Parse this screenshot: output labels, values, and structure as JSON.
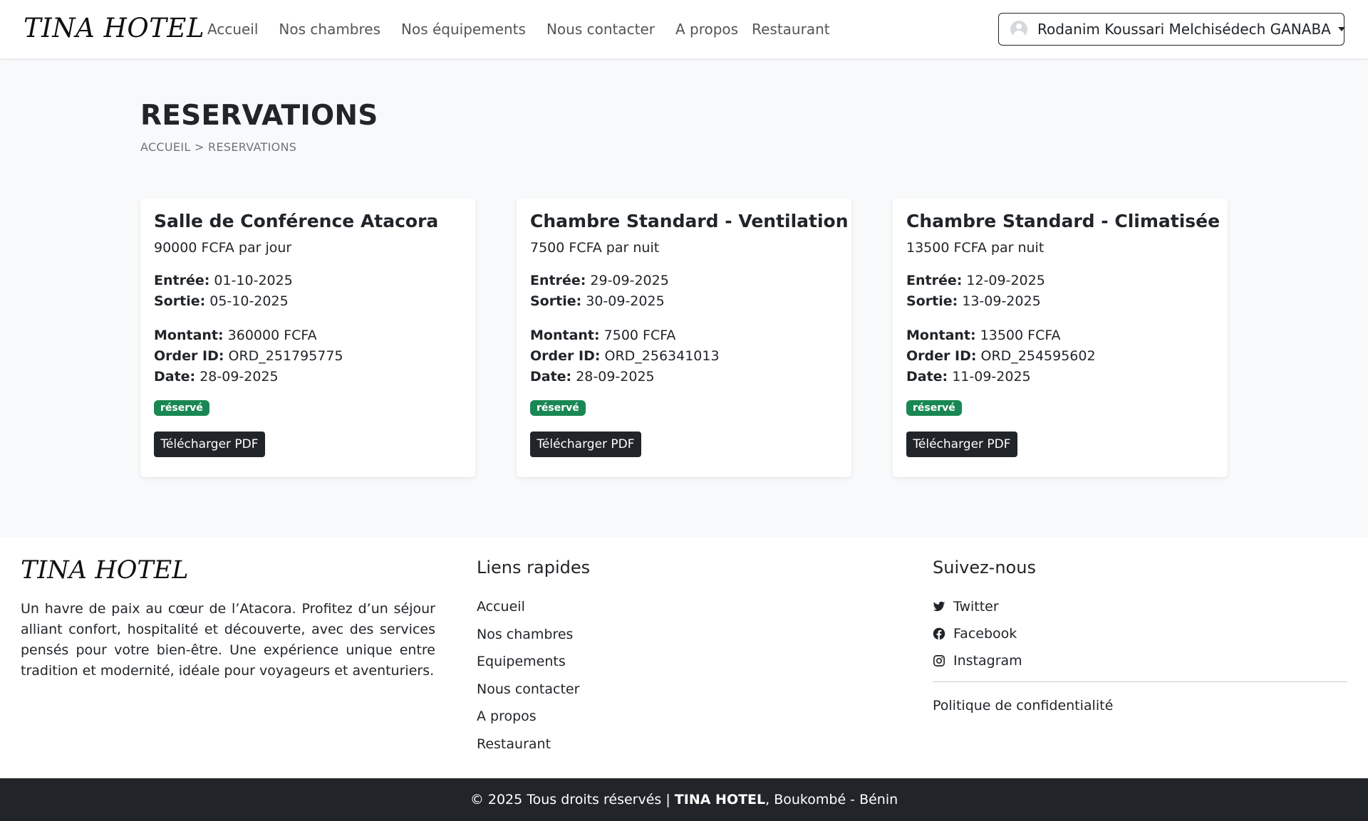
{
  "nav": {
    "brand": "TINA HOTEL",
    "links": [
      "Accueil",
      "Nos chambres",
      "Nos équipements",
      "Nous contacter",
      "A propos",
      "Restaurant"
    ],
    "user_name": "Rodanim Koussari Melchisédech GANABA"
  },
  "header": {
    "title": "RESERVATIONS",
    "breadcrumb": "ACCUEIL > RESERVATIONS"
  },
  "labels": {
    "entree": "Entrée:",
    "sortie": "Sortie:",
    "montant": "Montant:",
    "order_id": "Order ID:",
    "date": "Date:",
    "download": "Télécharger PDF"
  },
  "reservations": [
    {
      "title": "Salle de Conférence Atacora",
      "price": "90000 FCFA par jour",
      "entree": "01-10-2025",
      "sortie": "05-10-2025",
      "montant": "360000 FCFA",
      "order_id": "ORD_251795775",
      "date": "28-09-2025",
      "status": "réservé"
    },
    {
      "title": "Chambre Standard - Ventilation",
      "price": "7500 FCFA par nuit",
      "entree": "29-09-2025",
      "sortie": "30-09-2025",
      "montant": "7500 FCFA",
      "order_id": "ORD_256341013",
      "date": "28-09-2025",
      "status": "réservé"
    },
    {
      "title": "Chambre Standard - Climatisée",
      "price": "13500 FCFA par nuit",
      "entree": "12-09-2025",
      "sortie": "13-09-2025",
      "montant": "13500 FCFA",
      "order_id": "ORD_254595602",
      "date": "11-09-2025",
      "status": "réservé"
    }
  ],
  "footer": {
    "brand": "TINA HOTEL",
    "description": "Un havre de paix au cœur de l’Atacora. Profitez d’un séjour alliant confort, hospitalité et découverte, avec des services pensés pour votre bien-être. Une expérience unique entre tradition et modernité, idéale pour voyageurs et aventuriers.",
    "quick_links_title": "Liens rapides",
    "quick_links": [
      "Accueil",
      "Nos chambres",
      "Equipements",
      "Nous contacter",
      "A propos",
      "Restaurant"
    ],
    "social_title": "Suivez-nous",
    "social": [
      {
        "label": "Twitter",
        "icon": "twitter-icon"
      },
      {
        "label": "Facebook",
        "icon": "facebook-icon"
      },
      {
        "label": "Instagram",
        "icon": "instagram-icon"
      }
    ],
    "privacy": "Politique de confidentialité",
    "copyright_prefix": "© 2025 Tous droits réservés |",
    "copyright_brand": "TINA HOTEL",
    "copyright_suffix": ", Boukombé - Bénin"
  },
  "colors": {
    "badge_green": "#198754",
    "dark": "#212529",
    "page_bg": "#f8f9fa"
  }
}
